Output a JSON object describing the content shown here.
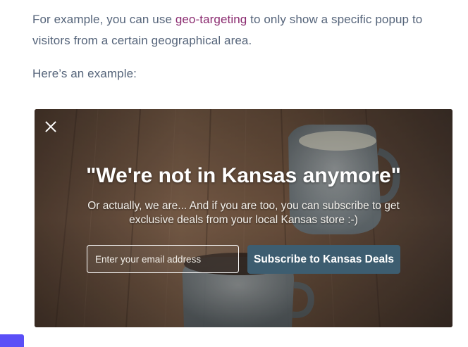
{
  "article": {
    "para1_before": "For example, you can use ",
    "para1_link": "geo-targeting",
    "para1_after": " to only show a specific popup to visitors from a certain geographical area.",
    "para2": "Here’s an example:"
  },
  "popup": {
    "headline": "\"We're not in Kansas anymore\"",
    "subtext": "Or actually, we are... And if you are too, you can subscribe to get exclusive deals from your local Kansas store :-)",
    "email_placeholder": "Enter your email address",
    "email_value": "",
    "subscribe_label": "Subscribe to Kansas Deals",
    "close_icon": "close-icon"
  },
  "colors": {
    "body_text": "#55647a",
    "link": "#8a2a6f",
    "button": "#3d5d70",
    "side_tab": "#5a4ff7"
  }
}
